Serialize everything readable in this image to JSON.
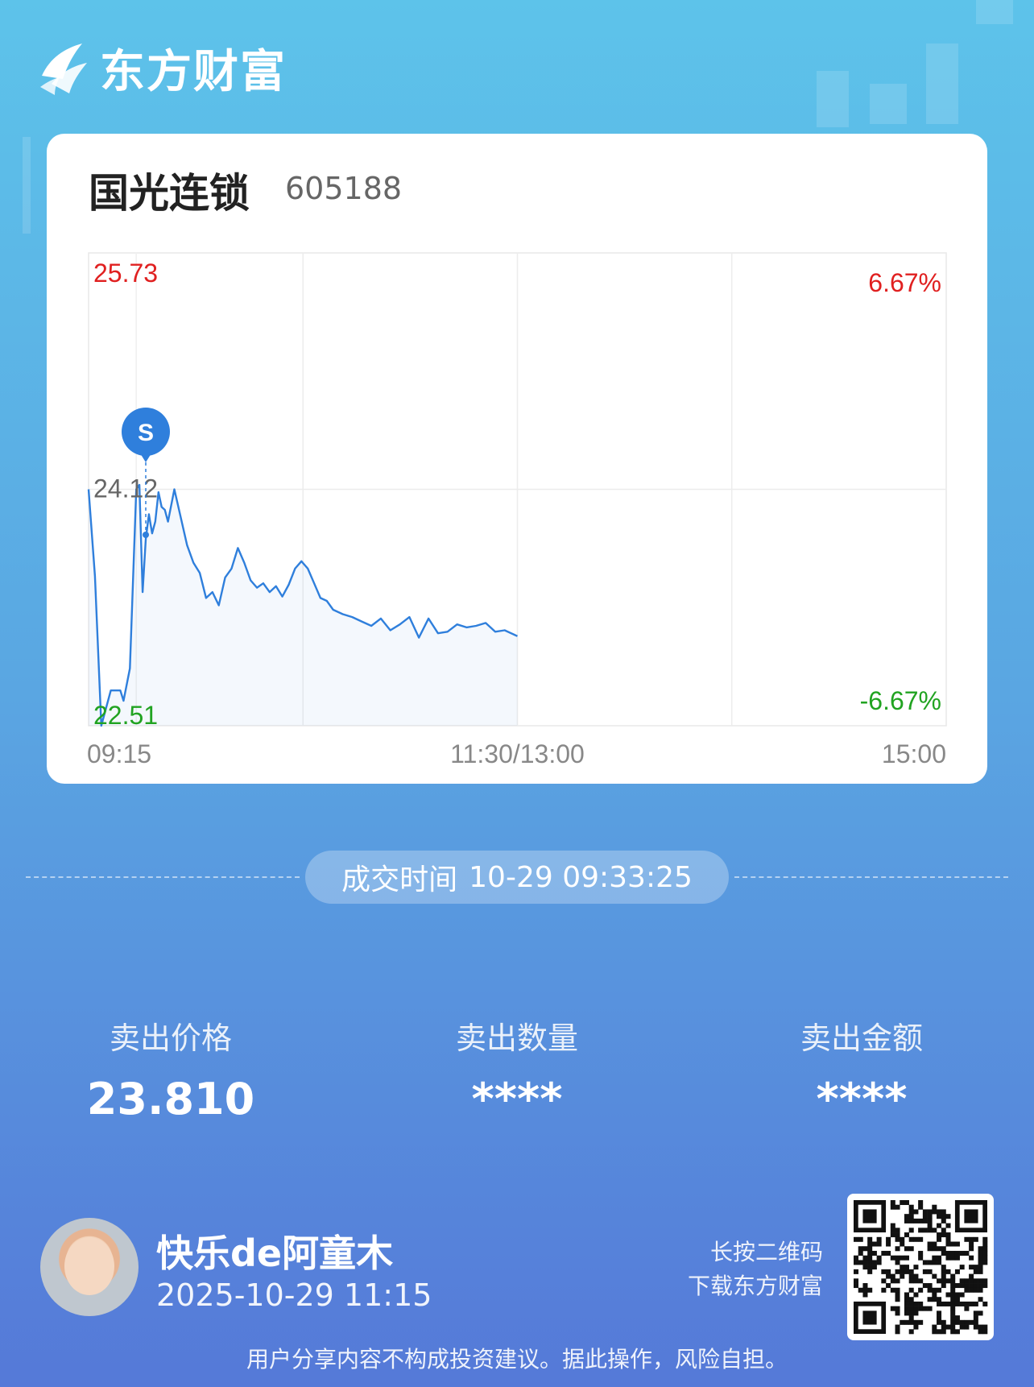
{
  "brand": {
    "name": "东方财富",
    "logo_icon": "eastmoney-logo-icon",
    "color": "#ffffff"
  },
  "stock": {
    "name": "国光连锁",
    "code": "605188"
  },
  "chart_data": {
    "type": "line",
    "y_high_label": "25.73",
    "y_mid_label": "24.12",
    "y_low_label": "22.51",
    "pct_high_label": "6.67%",
    "pct_low_label": "-6.67%",
    "x_tick_labels": [
      "09:15",
      "11:30/13:00",
      "15:00"
    ],
    "ylim": [
      22.51,
      25.73
    ],
    "reference_price": 24.12,
    "sell_marker": {
      "label": "S",
      "time": "09:33",
      "price": 23.81
    },
    "x": [
      "09:15",
      "09:17",
      "09:19",
      "09:22",
      "09:24",
      "09:25",
      "09:26",
      "09:28",
      "09:30",
      "09:31",
      "09:32",
      "09:33",
      "09:34",
      "09:35",
      "09:36",
      "09:37",
      "09:38",
      "09:39",
      "09:40",
      "09:42",
      "09:44",
      "09:46",
      "09:48",
      "09:50",
      "09:52",
      "09:54",
      "09:56",
      "09:58",
      "10:00",
      "10:02",
      "10:04",
      "10:06",
      "10:08",
      "10:10",
      "10:12",
      "10:14",
      "10:16",
      "10:18",
      "10:20",
      "10:22",
      "10:24",
      "10:26",
      "10:28",
      "10:30",
      "10:32",
      "10:35",
      "10:38",
      "10:41",
      "10:44",
      "10:47",
      "10:50",
      "10:53",
      "10:56",
      "10:59",
      "11:02",
      "11:05",
      "11:08",
      "11:11",
      "11:14",
      "11:17",
      "11:20",
      "11:23",
      "11:26",
      "11:29",
      "11:30"
    ],
    "values": [
      24.12,
      23.53,
      22.51,
      22.75,
      22.75,
      22.75,
      22.68,
      22.9,
      24.12,
      24.15,
      23.42,
      23.78,
      23.95,
      23.82,
      23.9,
      24.1,
      24.0,
      23.98,
      23.9,
      24.12,
      23.93,
      23.74,
      23.62,
      23.55,
      23.38,
      23.42,
      23.33,
      23.52,
      23.58,
      23.72,
      23.62,
      23.5,
      23.45,
      23.48,
      23.42,
      23.46,
      23.39,
      23.47,
      23.58,
      23.63,
      23.58,
      23.48,
      23.38,
      23.36,
      23.3,
      23.27,
      23.25,
      23.22,
      23.19,
      23.24,
      23.16,
      23.2,
      23.25,
      23.11,
      23.24,
      23.14,
      23.15,
      23.2,
      23.18,
      23.19,
      23.21,
      23.15,
      23.16,
      23.13,
      23.12
    ],
    "line_color": "#2f7fdc",
    "up_color": "#e02020",
    "down_color": "#21a321"
  },
  "trade_time": {
    "label": "成交时间",
    "value": "10-29 09:33:25"
  },
  "stats": [
    {
      "label": "卖出价格",
      "value": "23.810"
    },
    {
      "label": "卖出数量",
      "value": "****"
    },
    {
      "label": "卖出金额",
      "value": "****"
    }
  ],
  "user": {
    "name": "快乐de阿童木",
    "time": "2025-10-29 11:15",
    "avatar_icon": "user-avatar-icon"
  },
  "qr": {
    "tip_line1": "长按二维码",
    "tip_line2": "下载东方财富",
    "icon": "qr-code-icon"
  },
  "disclaimer": "用户分享内容不构成投资建议。据此操作，风险自担。"
}
